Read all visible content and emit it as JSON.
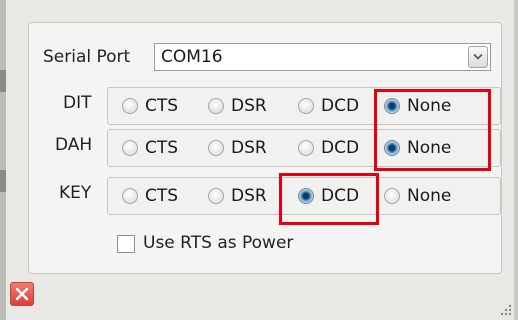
{
  "serial_port": {
    "label": "Serial Port",
    "value": "COM16",
    "dropdown_icon": "chevron-down-icon"
  },
  "rows": [
    {
      "label": "DIT",
      "options": [
        "CTS",
        "DSR",
        "DCD",
        "None"
      ],
      "selected": "None"
    },
    {
      "label": "DAH",
      "options": [
        "CTS",
        "DSR",
        "DCD",
        "None"
      ],
      "selected": "None"
    },
    {
      "label": "KEY",
      "options": [
        "CTS",
        "DSR",
        "DCD",
        "None"
      ],
      "selected": "DCD"
    }
  ],
  "rts_power": {
    "label": "Use RTS as Power",
    "checked": false
  },
  "close_icon": "close-icon",
  "colors": {
    "highlight": "#e8000d",
    "radio_selected": "#0f3f66",
    "close_button": "#d8403a"
  }
}
